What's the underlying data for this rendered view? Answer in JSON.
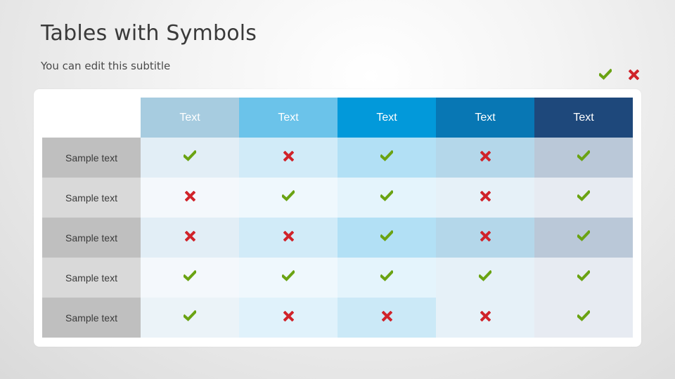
{
  "slide": {
    "title": "Tables with Symbols",
    "subtitle": "You can edit this subtitle"
  },
  "legend": [
    {
      "icon": "check-icon",
      "meaning": "yes"
    },
    {
      "icon": "cross-icon",
      "meaning": "no"
    }
  ],
  "colors": {
    "check": "#6aa313",
    "cross": "#d0232a",
    "header": [
      "#a7cce0",
      "#6bc3ea",
      "#0299da",
      "#0877b4",
      "#1e487b"
    ],
    "label_dark": "#bfbfbf",
    "label_light": "#d9d9d9",
    "cells_dark_rows": [
      "#e2eef6",
      "#d1ebf8",
      "#b2e0f5",
      "#b4d7ea",
      "#bac8d8"
    ],
    "cells_light_rows": [
      "#f4f8fc",
      "#eff8fd",
      "#e4f4fc",
      "#e6f1f8",
      "#e7ebf2"
    ],
    "cells_last_row": [
      "#ebf3f8",
      "#e0f2fb",
      "#cbe9f7",
      "#e6f1f8",
      "#e7ebf2"
    ]
  },
  "table": {
    "columns": [
      "Text",
      "Text",
      "Text",
      "Text",
      "Text"
    ],
    "rows": [
      {
        "label": "Sample text",
        "values": [
          "check",
          "cross",
          "check",
          "cross",
          "check"
        ]
      },
      {
        "label": "Sample text",
        "values": [
          "cross",
          "check",
          "check",
          "cross",
          "check"
        ]
      },
      {
        "label": "Sample text",
        "values": [
          "cross",
          "cross",
          "check",
          "cross",
          "check"
        ]
      },
      {
        "label": "Sample text",
        "values": [
          "check",
          "check",
          "check",
          "check",
          "check"
        ]
      },
      {
        "label": "Sample text",
        "values": [
          "check",
          "cross",
          "cross",
          "cross",
          "check"
        ]
      }
    ]
  }
}
